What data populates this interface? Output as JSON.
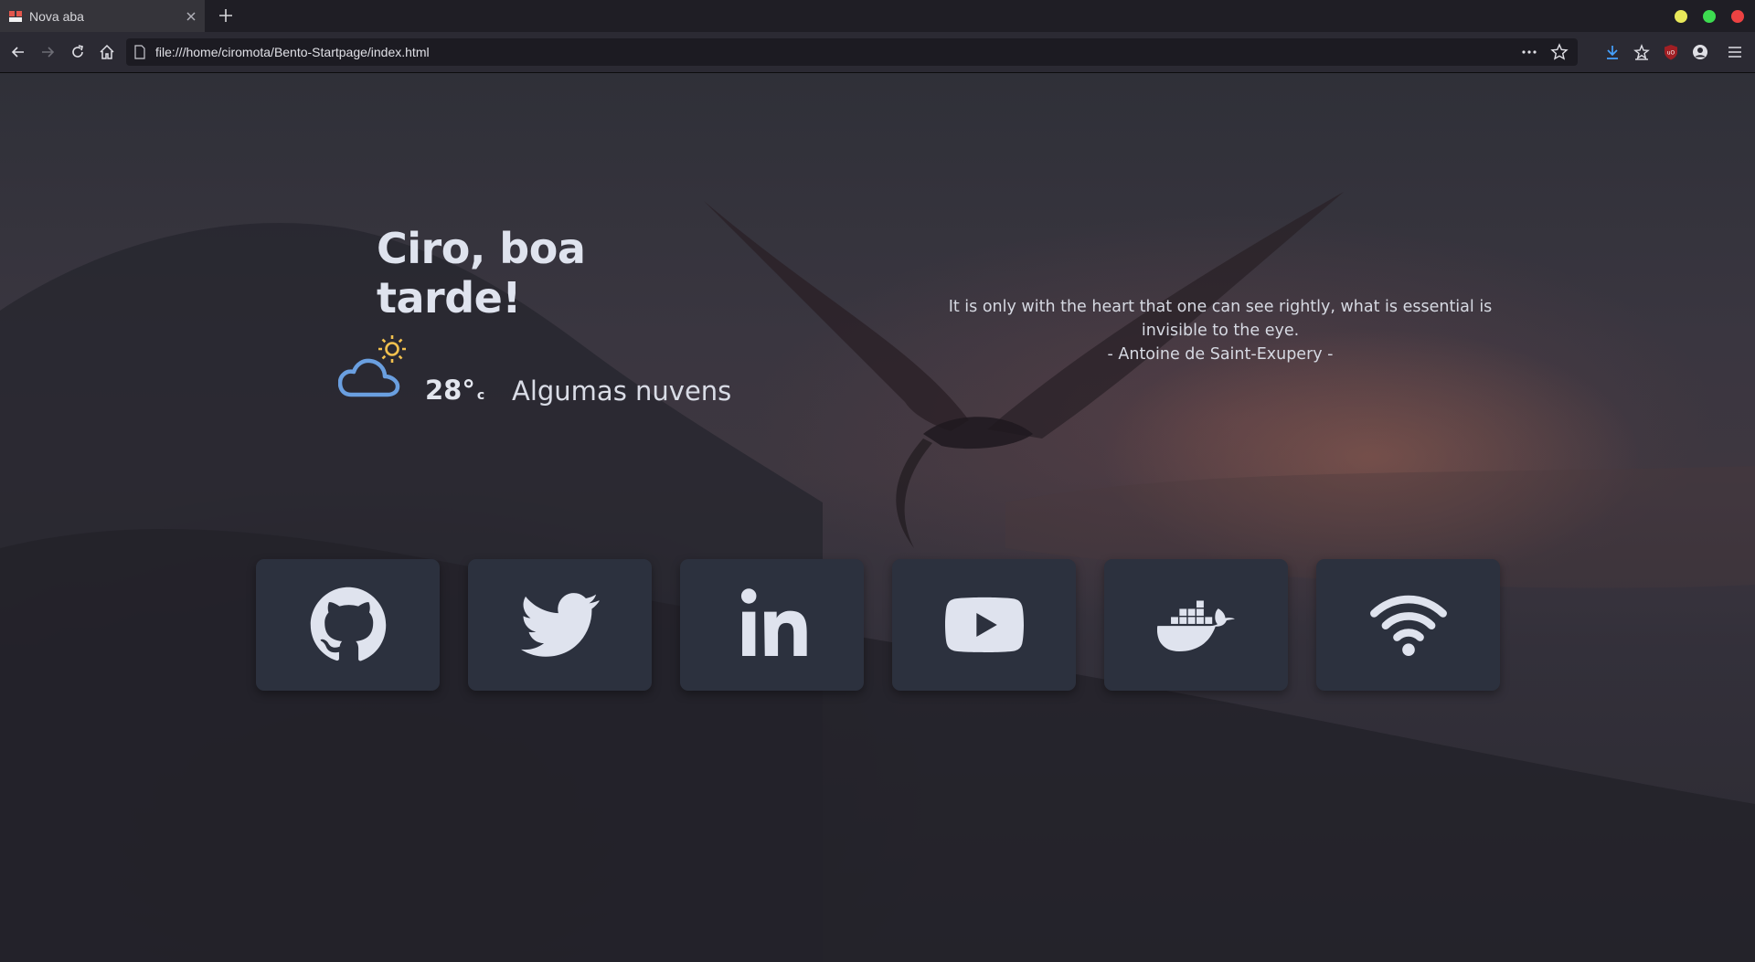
{
  "browser": {
    "tab_title": "Nova aba",
    "url": "file:///home/ciromota/Bento-Startpage/index.html",
    "window_buttons": {
      "minimize_color": "#e8e85a",
      "maximize_color": "#3ddc50",
      "close_color": "#ed4242"
    }
  },
  "page": {
    "greeting": "Ciro, boa tarde!",
    "weather": {
      "icon": "partly-cloudy-icon",
      "temperature": "28°",
      "unit": "c",
      "condition": "Algumas nuvens"
    },
    "quote": {
      "text": "It is only with the heart that one can see rightly, what is essential is invisible to the eye.",
      "author": "- Antoine de Saint-Exupery -"
    },
    "links": [
      {
        "icon": "github-icon"
      },
      {
        "icon": "twitter-icon"
      },
      {
        "icon": "linkedin-icon"
      },
      {
        "icon": "youtube-icon"
      },
      {
        "icon": "docker-icon"
      },
      {
        "icon": "wifi-icon"
      }
    ],
    "colors": {
      "card_bg": "#2c313e",
      "icon_color": "#dfe3ee",
      "cloud_color": "#6a9fe0",
      "sun_color": "#f2c14e"
    }
  }
}
